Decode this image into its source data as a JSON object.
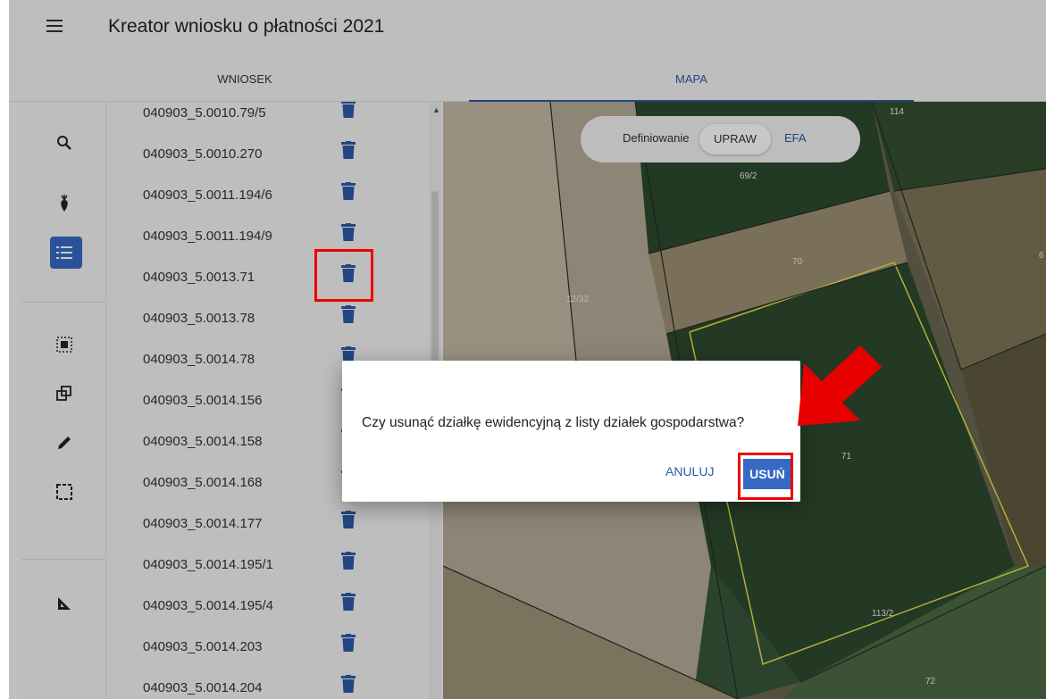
{
  "header": {
    "title": "Kreator wniosku o płatności 2021",
    "menu_icon": "hamburger-menu-icon"
  },
  "tabs": [
    {
      "label": "WNIOSEK",
      "active": false
    },
    {
      "label": "MAPA",
      "active": true
    }
  ],
  "rail": {
    "icons": [
      "search-icon",
      "plant-icon",
      "list-icon",
      "select-area-icon",
      "copy-icon",
      "pencil-icon",
      "rectangle-select-icon",
      "measure-icon"
    ],
    "active": "list-icon"
  },
  "parcels": [
    "040903_5.0010.79/5",
    "040903_5.0010.270",
    "040903_5.0011.194/6",
    "040903_5.0011.194/9",
    "040903_5.0013.71",
    "040903_5.0013.78",
    "040903_5.0014.78",
    "040903_5.0014.156",
    "040903_5.0014.158",
    "040903_5.0014.168",
    "040903_5.0014.177",
    "040903_5.0014.195/1",
    "040903_5.0014.195/4",
    "040903_5.0014.203",
    "040903_5.0014.204"
  ],
  "map": {
    "toggle_label": "Definiowanie",
    "toggle_upraw": "UPRAW",
    "toggle_efa": "EFA",
    "labels": [
      "114",
      "69/2",
      "70",
      "6",
      "12/32",
      "71",
      "113/2",
      "72"
    ]
  },
  "dialog": {
    "message": "Czy usunąć działkę ewidencyjną z listy działek gospodarstwa?",
    "cancel_label": "ANULUJ",
    "confirm_label": "USUŃ"
  },
  "colors": {
    "accent": "#3569c4",
    "highlight": "#e00000"
  }
}
